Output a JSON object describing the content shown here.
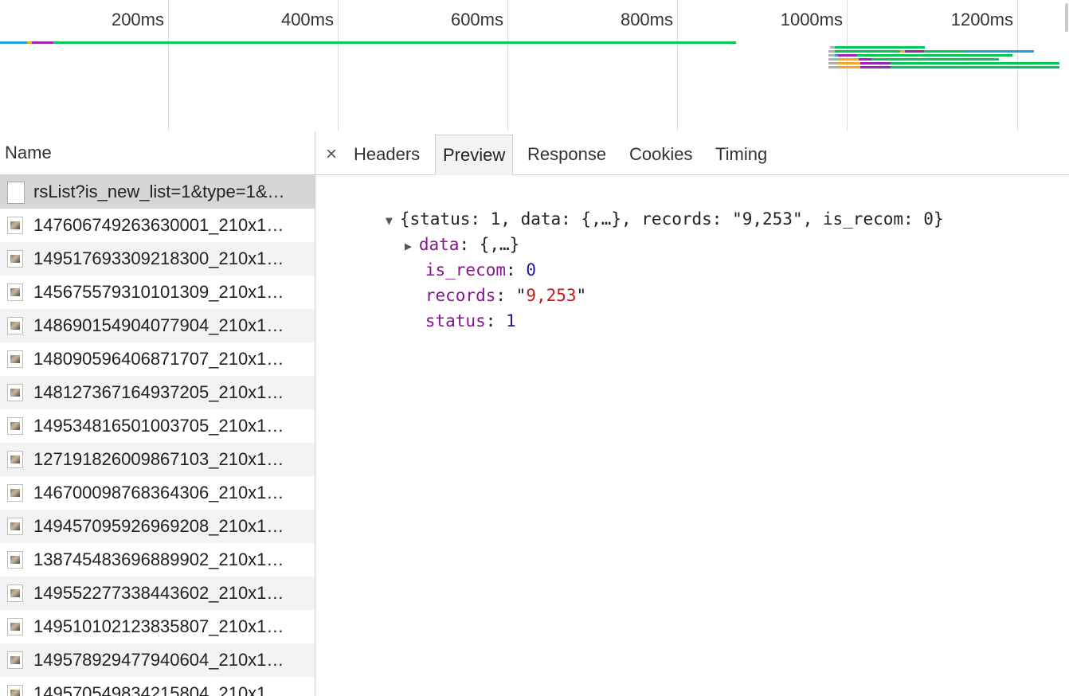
{
  "timeline": {
    "ticks": [
      "200ms",
      "400ms",
      "600ms",
      "800ms",
      "1000ms",
      "1200ms"
    ],
    "colors": {
      "waiting": "#00c853",
      "connect": "#f5a623",
      "ssl": "#9c27b0",
      "dns": "#1e9fe0",
      "stalled": "#b0b0b0"
    }
  },
  "request_list": {
    "header": "Name",
    "rows": [
      {
        "name": "rsList?is_new_list=1&type=1&…",
        "type": "doc",
        "selected": true
      },
      {
        "name": "147606749263630001_210x1…",
        "type": "img"
      },
      {
        "name": "149517693309218300_210x1…",
        "type": "img"
      },
      {
        "name": "145675579310101309_210x1…",
        "type": "img"
      },
      {
        "name": "148690154904077904_210x1…",
        "type": "img"
      },
      {
        "name": "148090596406871707_210x1…",
        "type": "img"
      },
      {
        "name": "148127367164937205_210x1…",
        "type": "img"
      },
      {
        "name": "149534816501003705_210x1…",
        "type": "img"
      },
      {
        "name": "127191826009867103_210x1…",
        "type": "img"
      },
      {
        "name": "146700098768364306_210x1…",
        "type": "img"
      },
      {
        "name": "149457095926969208_210x1…",
        "type": "img"
      },
      {
        "name": "138745483696889902_210x1…",
        "type": "img"
      },
      {
        "name": "149552277338443602_210x1…",
        "type": "img"
      },
      {
        "name": "149510102123835807_210x1…",
        "type": "img"
      },
      {
        "name": "149578929477940604_210x1…",
        "type": "img"
      },
      {
        "name": "149570549834215804_210x1…",
        "type": "img"
      }
    ]
  },
  "detail": {
    "close_icon": "×",
    "tabs": [
      "Headers",
      "Preview",
      "Response",
      "Cookies",
      "Timing"
    ],
    "active_tab": "Preview",
    "preview": {
      "summary": "{status: 1, data: {,…}, records: \"9,253\", is_recom: 0}",
      "data_key": "data",
      "data_value": "{,…}",
      "is_recom_key": "is_recom",
      "is_recom_value": "0",
      "records_key": "records",
      "records_value": "9,253",
      "status_key": "status",
      "status_value": "1"
    }
  }
}
